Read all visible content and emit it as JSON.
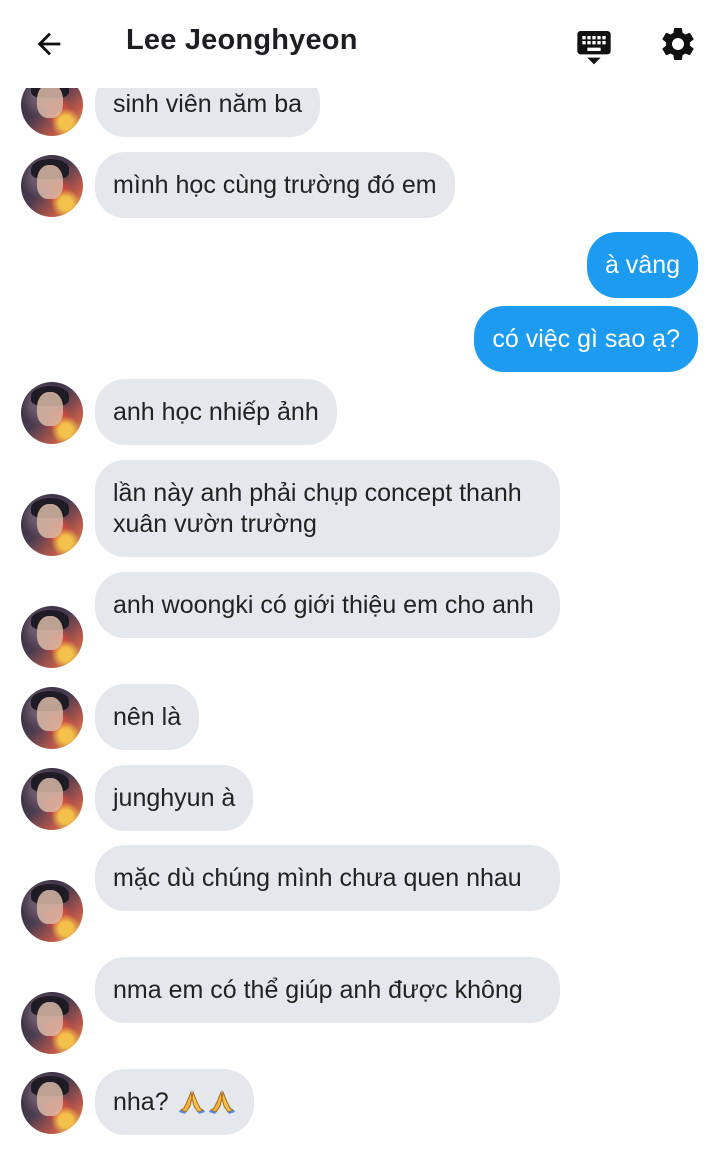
{
  "header": {
    "title": "Lee Jeonghyeon",
    "back_icon": "arrow-left-icon",
    "keyboard_icon": "keyboard-icon",
    "settings_icon": "gear-icon"
  },
  "colors": {
    "incoming_bubble": "#e4e8ec",
    "outgoing_bubble": "#1d9bf0",
    "text": "#1c1e21"
  },
  "messages": [
    {
      "dir": "in",
      "text": "sinh viên năm ba"
    },
    {
      "dir": "in",
      "text": "mình học cùng trường đó em"
    },
    {
      "dir": "out",
      "text": "à vâng"
    },
    {
      "dir": "out",
      "text": "có việc gì sao ạ?"
    },
    {
      "dir": "in",
      "text": "anh học nhiếp ảnh"
    },
    {
      "dir": "in",
      "text": "lần này anh phải chụp concept thanh xuân vườn trường"
    },
    {
      "dir": "in",
      "text": "anh woongki có giới thiệu em cho anh"
    },
    {
      "dir": "in",
      "text": "nên là"
    },
    {
      "dir": "in",
      "text": "junghyun à"
    },
    {
      "dir": "in",
      "text": "mặc dù chúng mình chưa quen nhau"
    },
    {
      "dir": "in",
      "text": "nma em có thể giúp anh được không"
    },
    {
      "dir": "in",
      "text": "nha?",
      "emoji": [
        "folded-hands-emoji",
        "folded-hands-emoji"
      ]
    }
  ]
}
